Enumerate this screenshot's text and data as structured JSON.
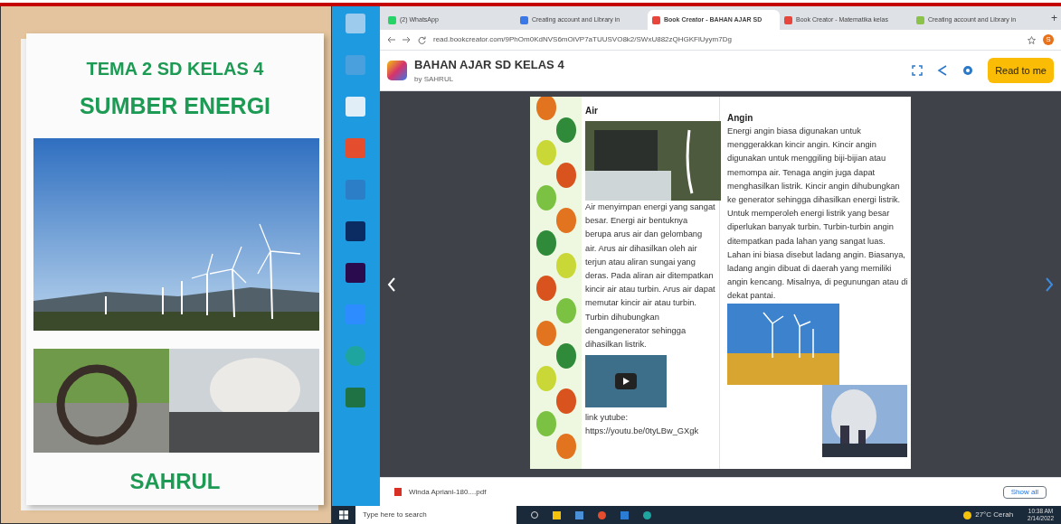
{
  "cover": {
    "theme": "TEMA 2 SD KELAS 4",
    "title": "SUMBER ENERGI",
    "author": "SAHRUL"
  },
  "browser": {
    "tabs": [
      {
        "title": "(2) WhatsApp",
        "selected": false,
        "color": "#25d366"
      },
      {
        "title": "Creating account and Library in",
        "selected": false,
        "color": "#3b78e7"
      },
      {
        "title": "Book Creator - BAHAN AJAR SD",
        "selected": true,
        "color": "#e8453c"
      },
      {
        "title": "Book Creator - Matematika kelas",
        "selected": false,
        "color": "#e8453c"
      },
      {
        "title": "Creating account and Library in",
        "selected": false,
        "color": "#8bc34a"
      }
    ],
    "new_tab": "+",
    "address": "read.bookcreator.com/9PhOm0KdNVS6mOiVP7aTUUSVO8k2/SWxU882zQHGKFlUyym7Dg",
    "profile_initial": "S"
  },
  "app": {
    "title": "BAHAN AJAR SD KELAS 4",
    "byline": "by SAHRUL",
    "read_button": "Read to me"
  },
  "book": {
    "left_page": {
      "heading": "Air",
      "body": "Air menyimpan energi yang sangat besar. Energi air bentuknya berupa arus air dan gelombang air. Arus air dihasilkan oleh air terjun atau aliran sungai yang deras. Pada aliran air ditempatkan kincir air atau turbin. Arus air dapat memutar kincir air atau turbin. Turbin dihubungkan dengangenerator sehingga dihasilkan listrik.",
      "link_label": "link yutube:",
      "link_url": "https://youtu.be/0tyLBw_GXgk"
    },
    "right_page": {
      "heading": "Angin",
      "body": "Energi angin biasa digunakan untuk menggerakkan kincir angin. Kincir angin digunakan untuk menggiling biji-bijian atau memompa air. Tenaga angin juga dapat menghasilkan listrik. Kincir angin dihubungkan ke generator sehingga dihasilkan energi listrik. Untuk memperoleh energi listrik yang besar diperlukan banyak turbin. Turbin-turbin angin ditempatkan pada lahan yang sangat luas. Lahan ini biasa disebut ladang angin. Biasanya, ladang angin dibuat di daerah yang memiliki angin kencang. Misalnya, di pegunungan atau di dekat pantai."
    }
  },
  "download_bar": {
    "file": "Winda Apriani-180....pdf",
    "show_all": "Show all"
  },
  "taskbar": {
    "search_placeholder": "Type here to search",
    "weather": "27°C Cerah",
    "time": "10:38 AM",
    "date": "2/14/2022"
  }
}
